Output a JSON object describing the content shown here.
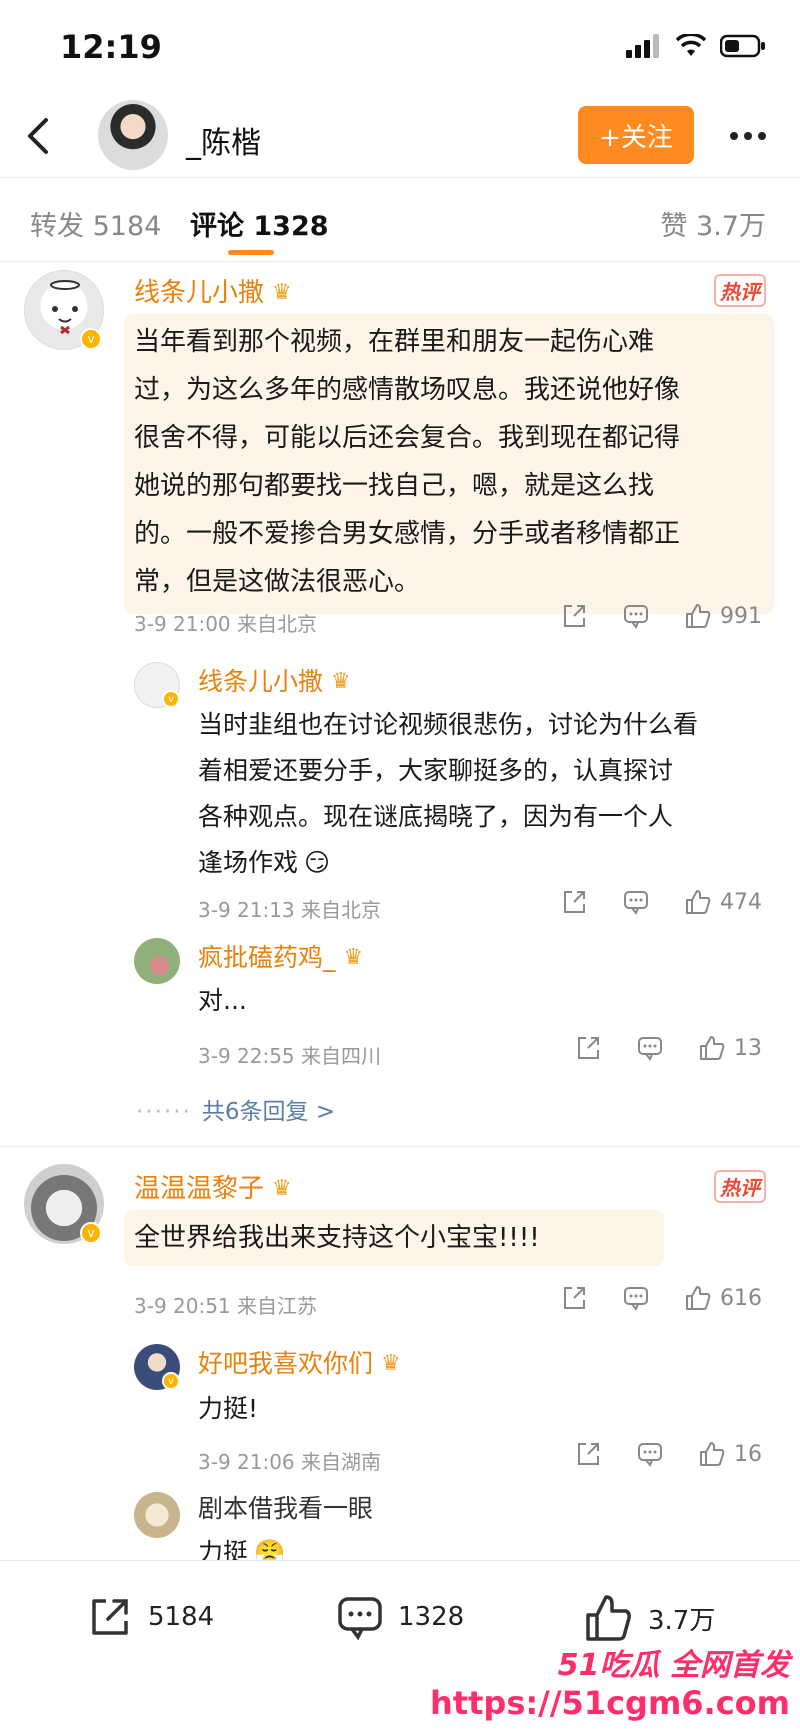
{
  "status_bar": {
    "time": "12:19"
  },
  "header": {
    "user_name": "_陈楷",
    "follow_label": "+关注"
  },
  "tabs": {
    "repost": "转发 5184",
    "comment": "评论 1328",
    "like": "赞 3.7万"
  },
  "comments": [
    {
      "user": "线条儿小撒",
      "hot": "热评",
      "text_lines": [
        "当年看到那个视频，在群里和朋友一起伤心难",
        "过，为这么多年的感情散场叹息。我还说他好像",
        "很舍不得，可能以后还会复合。我到现在都记得",
        "她说的那句都要找一找自己，嗯，就是这么找",
        "的。一般不爱掺合男女感情，分手或者移情都正",
        "常，但是这做法很恶心。"
      ],
      "meta": "3-9 21:00 来自北京",
      "likes": "991",
      "replies": [
        {
          "user": "线条儿小撒",
          "text_lines": [
            "当时韭组也在讨论视频很悲伤，讨论为什么看",
            "着相爱还要分手，大家聊挺多的，认真探讨",
            "各种观点。现在谜底揭晓了，因为有一个人",
            "逢场作戏"
          ],
          "meta": "3-9 21:13 来自北京",
          "likes": "474"
        },
        {
          "user": "疯批磕药鸡_",
          "text_lines": [
            "对..."
          ],
          "meta": "3-9 22:55 来自四川",
          "likes": "13"
        }
      ],
      "more_replies": "共6条回复 >"
    },
    {
      "user": "温温温黎子",
      "hot": "热评",
      "text_lines": [
        "全世界给我出来支持这个小宝宝!!!!"
      ],
      "meta": "3-9 20:51 来自江苏",
      "likes": "616",
      "replies": [
        {
          "user": "好吧我喜欢你们",
          "text_lines": [
            "力挺!"
          ],
          "meta": "3-9 21:06 来自湖南",
          "likes": "16"
        },
        {
          "user": "剧本借我看一眼",
          "text_lines": [
            "力挺"
          ]
        }
      ]
    }
  ],
  "bottom_bar": {
    "repost": "5184",
    "comment": "1328",
    "like": "3.7万"
  },
  "watermark": {
    "line1": "51吃瓜 全网首发",
    "line2": "https://51cgm6.com"
  },
  "colors": {
    "accent": "#ff8a1f",
    "username": "#e8820c",
    "link": "#5b7ea8"
  }
}
